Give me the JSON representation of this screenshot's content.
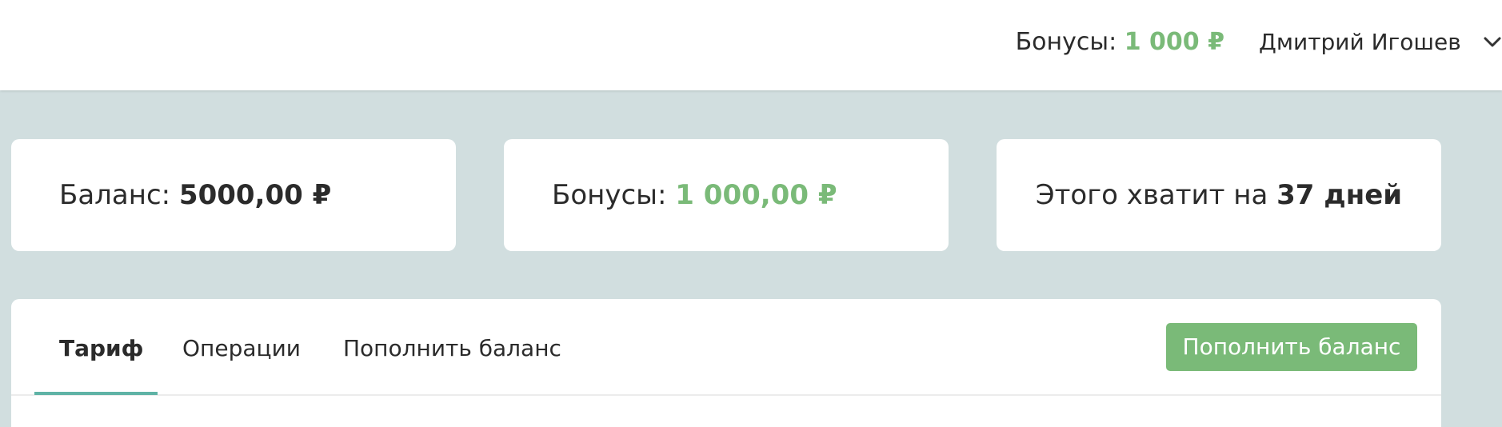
{
  "header": {
    "bonus_label": "Бонусы:",
    "bonus_value": "1 000 ₽",
    "user_name": "Дмитрий Игошев",
    "user_menu_icon": "chevron-down-icon"
  },
  "cards": {
    "balance": {
      "label": "Баланс:",
      "value": "5000,00 ₽"
    },
    "bonuses": {
      "label": "Бонусы:",
      "value": "1 000,00 ₽"
    },
    "duration": {
      "label": "Этого хватит на",
      "value": "37 дней"
    }
  },
  "tabs": [
    {
      "label": "Тариф",
      "active": true
    },
    {
      "label": "Операции",
      "active": false
    },
    {
      "label": "Пополнить баланс",
      "active": false
    }
  ],
  "actions": {
    "topup_label": "Пополнить баланс"
  },
  "colors": {
    "accent_green": "#7aba78",
    "tab_underline": "#5fb3a6",
    "background": "#d1dedf"
  }
}
